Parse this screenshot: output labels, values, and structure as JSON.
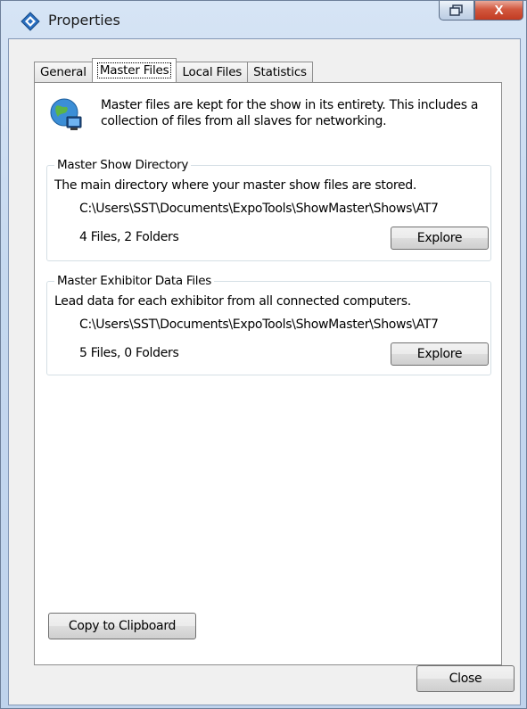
{
  "window": {
    "title": "Properties",
    "icon": "properties-diamond-icon",
    "close_glyph": "X"
  },
  "tabs": [
    {
      "label": "General",
      "active": false
    },
    {
      "label": "Master Files",
      "active": true
    },
    {
      "label": "Local Files",
      "active": false
    },
    {
      "label": "Statistics",
      "active": false
    }
  ],
  "intro": {
    "icon": "globe-network-icon",
    "text": "Master files are kept for the show in its entirety.  This includes a collection of files from all slaves for networking."
  },
  "master_show_directory": {
    "title": "Master Show Directory",
    "description": "The main directory where your master show files are stored.",
    "path": "C:\\Users\\SST\\Documents\\ExpoTools\\ShowMaster\\Shows\\AT7",
    "count": "4 Files, 2 Folders",
    "button_label": "Explore"
  },
  "master_exhibitor_data": {
    "title": "Master Exhibitor Data Files",
    "description": "Lead data for each exhibitor from all connected computers.",
    "path": "C:\\Users\\SST\\Documents\\ExpoTools\\ShowMaster\\Shows\\AT7",
    "count": "5 Files, 0 Folders",
    "button_label": "Explore"
  },
  "footer": {
    "copy_label": "Copy to Clipboard",
    "close_label": "Close"
  }
}
